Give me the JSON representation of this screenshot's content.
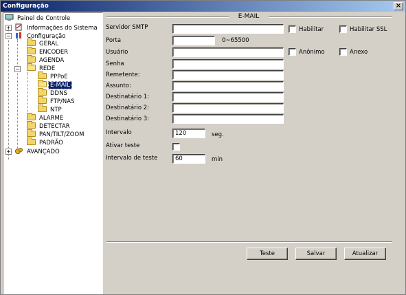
{
  "window": {
    "title": "Configuração",
    "close_label": "×"
  },
  "tree": {
    "root": "Painel de Controle",
    "info": "Informações do Sistema",
    "config": "Configuração",
    "geral": "GERAL",
    "encoder": "ENCODER",
    "agenda": "AGENDA",
    "rede": "REDE",
    "pppoe": "PPPoE",
    "email": "E-MAIL",
    "ddns": "DDNS",
    "ftp": "FTP/NAS",
    "ntp": "NTP",
    "alarme": "ALARME",
    "detectar": "DETECTAR",
    "pan": "PAN/TILT/ZOOM",
    "padrao": "PADRÃO",
    "avancado": "AVANÇADO",
    "expand_plus": "+",
    "expand_minus": "−"
  },
  "form": {
    "section_title": "E-MAIL",
    "smtp_label": "Servidor SMTP",
    "smtp_value": "",
    "habilitar_label": "Habilitar",
    "habilitar_ssl_label": "Habilitar SSL",
    "porta_label": "Porta",
    "porta_value": "",
    "porta_range": "0~65500",
    "usuario_label": "Usuário",
    "usuario_value": "",
    "anonimo_label": "Anônimo",
    "anexo_label": "Anexo",
    "senha_label": "Senha",
    "senha_value": "",
    "remetente_label": "Remetente:",
    "remetente_value": "",
    "assunto_label": "Assunto:",
    "assunto_value": "",
    "dest1_label": "Destinatário 1:",
    "dest1_value": "",
    "dest2_label": "Destinatário 2:",
    "dest2_value": "",
    "dest3_label": "Destinatário 3:",
    "dest3_value": "",
    "intervalo_label": "Intervalo",
    "intervalo_value": "120",
    "intervalo_unit": "seg.",
    "ativar_teste_label": "Ativar teste",
    "intervalo_teste_label": "Intervalo de teste",
    "intervalo_teste_value": "60",
    "intervalo_teste_unit": "min"
  },
  "buttons": {
    "teste": "Teste",
    "salvar": "Salvar",
    "atualizar": "Atualizar"
  }
}
